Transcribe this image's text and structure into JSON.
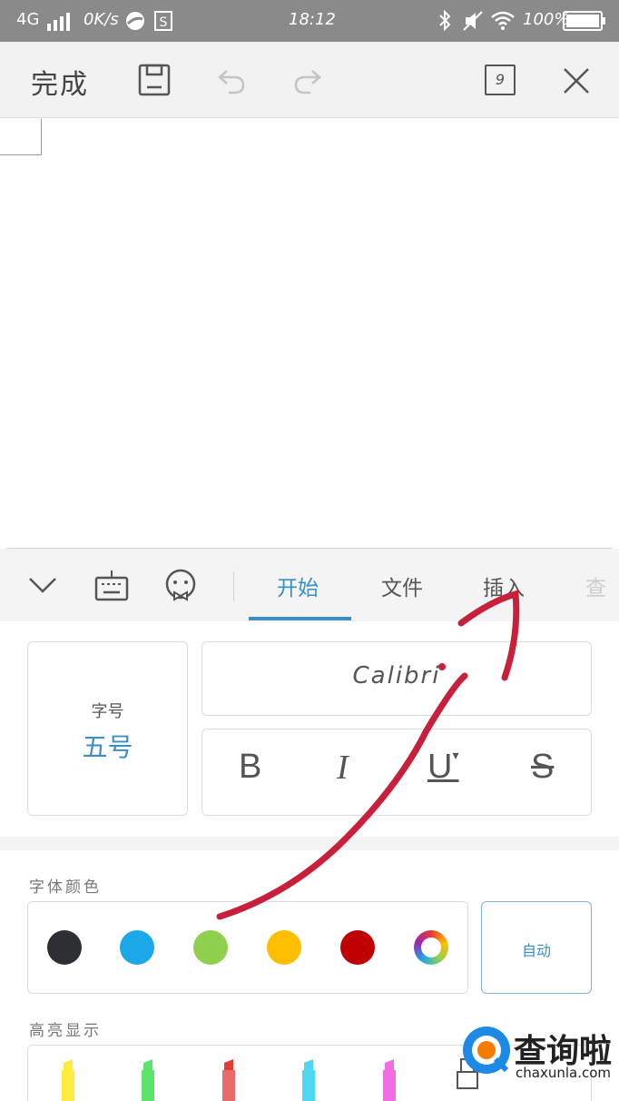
{
  "status_bar": {
    "network": "4G",
    "speed": "0K/s",
    "time": "18:12",
    "battery": "100%"
  },
  "toolbar": {
    "done_label": "完成",
    "page_count": "9"
  },
  "tabs": [
    {
      "label": "开始",
      "active": true
    },
    {
      "label": "文件",
      "active": false
    },
    {
      "label": "插入",
      "active": false
    },
    {
      "label": "查",
      "active": false
    }
  ],
  "font": {
    "size_title": "字号",
    "size_value": "五号",
    "font_name": "Calibri"
  },
  "format_buttons": [
    "B",
    "I",
    "U",
    "S"
  ],
  "font_color": {
    "title": "字体颜色",
    "swatches": [
      "#2d2f33",
      "#1ba7e8",
      "#8fd14f",
      "#ffbf00",
      "#c00000"
    ],
    "auto_label": "自动"
  },
  "highlight": {
    "title": "高亮显示",
    "colors": [
      "#ffeb3b",
      "#5ee46a",
      "#e53935",
      "#4dd7f0",
      "#f06ee0"
    ]
  },
  "watermark": {
    "name": "查询啦",
    "domain": "chaxunla.com"
  },
  "colors": {
    "accent": "#3a8fc9",
    "annotation": "#c8203a"
  }
}
